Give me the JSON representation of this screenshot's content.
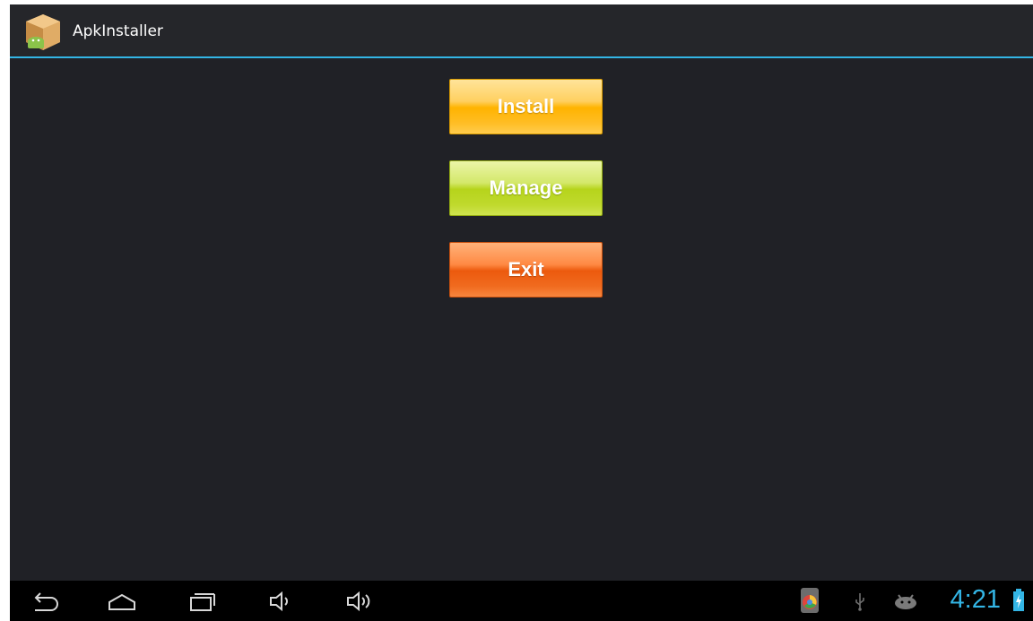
{
  "app": {
    "title": "ApkInstaller",
    "icon": "apk-installer-box-icon"
  },
  "buttons": {
    "install": "Install",
    "manage": "Manage",
    "exit": "Exit"
  },
  "navbar": {
    "icons": [
      "back-icon",
      "home-icon",
      "recents-icon",
      "volume-down-icon",
      "volume-up-icon"
    ]
  },
  "status": {
    "time": "4:21",
    "icons": [
      "app-notification-icon",
      "usb-icon",
      "android-debug-icon",
      "battery-charging-icon"
    ]
  },
  "colors": {
    "accent": "#33b5e5",
    "background": "#202126",
    "install": "#ffb300",
    "manage": "#b6d41c",
    "exit": "#ec5a0e"
  }
}
